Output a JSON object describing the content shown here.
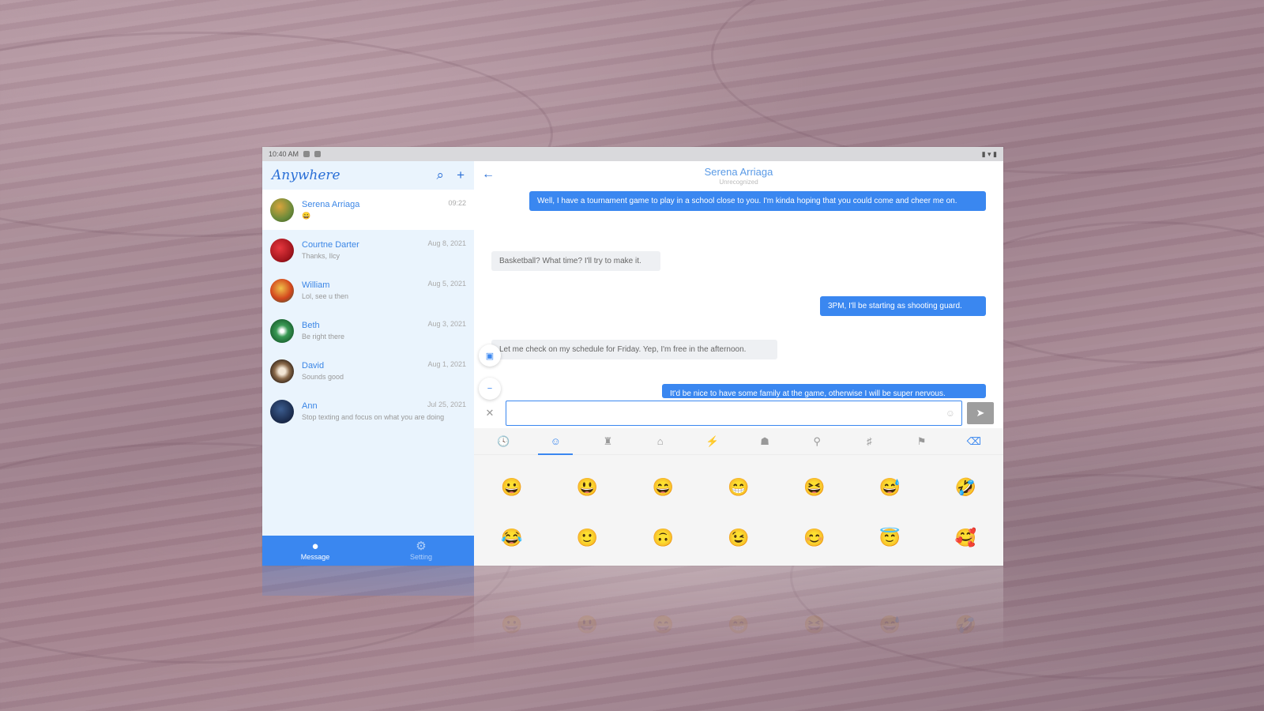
{
  "status_bar": {
    "time": "10:40 AM",
    "right_icons": "▮ ▾ ▮"
  },
  "sidebar": {
    "app_name": "Anywhere",
    "conversations": [
      {
        "name": "Serena Arriaga",
        "preview": "😀",
        "date": "09:22",
        "avatar_color": "#6b8a3a"
      },
      {
        "name": "Courtne Darter",
        "preview": "Thanks, Ilcy",
        "date": "Aug 8, 2021",
        "avatar_color": "#c0202a"
      },
      {
        "name": "William",
        "preview": "Lol, see u then",
        "date": "Aug 5, 2021",
        "avatar_color": "#d2451c"
      },
      {
        "name": "Beth",
        "preview": "Be right there",
        "date": "Aug 3, 2021",
        "avatar_color": "#3a9a55"
      },
      {
        "name": "David",
        "preview": "Sounds good",
        "date": "Aug 1, 2021",
        "avatar_color": "#8a6a4a"
      },
      {
        "name": "Ann",
        "preview": "Stop texting and focus on what you are doing",
        "date": "Jul 25, 2021",
        "avatar_color": "#1d2f52"
      }
    ],
    "nav": {
      "messages": "Message",
      "settings": "Setting"
    }
  },
  "chat": {
    "contact_name": "Serena Arriaga",
    "contact_sub": "Unrecognized",
    "messages": [
      {
        "dir": "out",
        "text": "Well, I have a tournament game to play in a school close to you. I'm kinda hoping that you could come and cheer me on."
      },
      {
        "dir": "in",
        "text": "Basketball? What time? I'll try to make it."
      },
      {
        "dir": "out",
        "text": "3PM, I'll be starting as shooting guard."
      },
      {
        "dir": "in",
        "text": "Let me check on my schedule for Friday. Yep, I'm free in the afternoon."
      },
      {
        "dir": "out",
        "text": "It'd be nice to have some family at the game, otherwise I will be super nervous."
      }
    ],
    "input_placeholder": ""
  },
  "emoji_panel": {
    "tabs": [
      "🕓",
      "☺",
      "♜",
      "⌂",
      "⚡",
      "☗",
      "⚲",
      "♯",
      "⚑",
      "⌫"
    ],
    "row1": [
      "😀",
      "😃",
      "😄",
      "😁",
      "😆",
      "😅",
      "🤣"
    ],
    "row2": [
      "😂",
      "🙂",
      "🙃",
      "😉",
      "😊",
      "😇",
      "🥰"
    ]
  },
  "colors": {
    "accent": "#3a87f0",
    "sidebar_bg": "#eaf4fd"
  }
}
